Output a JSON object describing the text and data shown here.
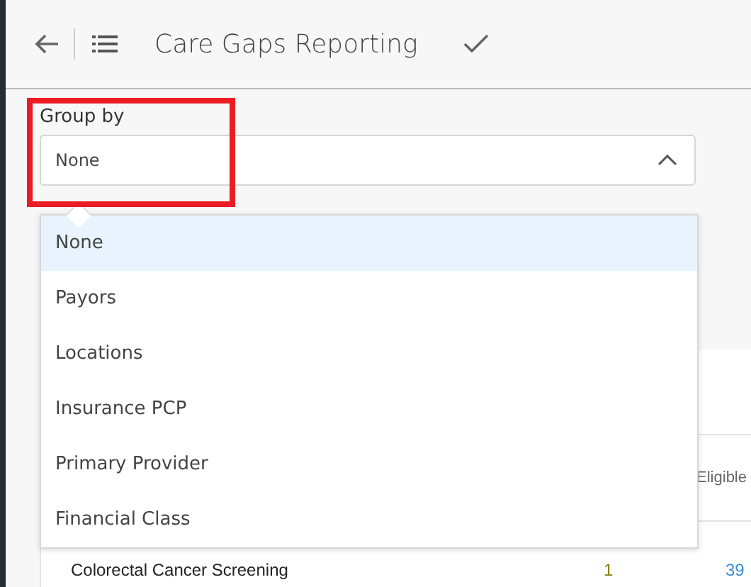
{
  "header": {
    "title": "Care Gaps Reporting"
  },
  "group_by": {
    "label": "Group by",
    "value": "None",
    "expanded": true
  },
  "dropdown": {
    "options": [
      {
        "label": "None",
        "selected": true
      },
      {
        "label": "Payors",
        "selected": false
      },
      {
        "label": "Locations",
        "selected": false
      },
      {
        "label": "Insurance PCP",
        "selected": false
      },
      {
        "label": "Primary Provider",
        "selected": false
      },
      {
        "label": "Financial Class",
        "selected": false
      }
    ]
  },
  "table": {
    "columns": [
      "Eligible"
    ],
    "rows": [
      {
        "name": "Colorectal Cancer Screening",
        "column_2": "1",
        "column_3": "39"
      }
    ]
  }
}
